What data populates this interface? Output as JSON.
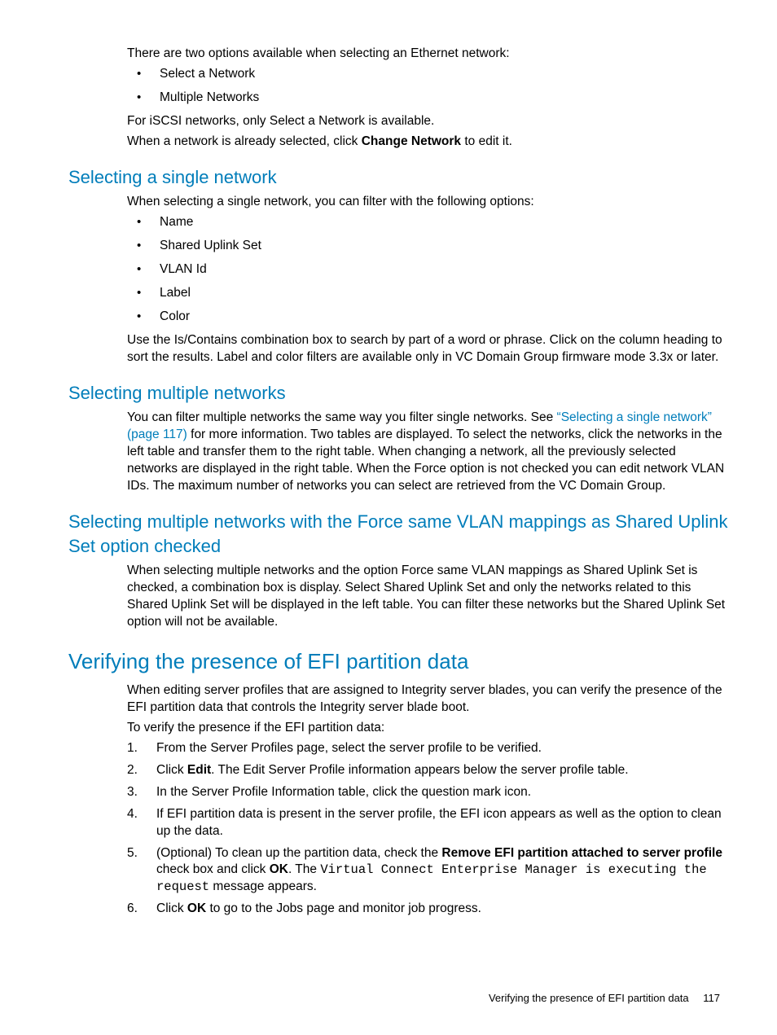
{
  "intro": {
    "lead": "There are two options available when selecting an Ethernet network:",
    "options": [
      "Select a Network",
      "Multiple Networks"
    ],
    "iscsi": "For iSCSI networks, only Select a Network is available.",
    "change_pre": "When a network is already selected, click ",
    "change_bold": "Change Network",
    "change_post": " to edit it."
  },
  "single": {
    "heading": "Selecting a single network",
    "lead": "When selecting a single network, you can filter with the following options:",
    "filters": [
      "Name",
      "Shared Uplink Set",
      "VLAN Id",
      "Label",
      "Color"
    ],
    "note": "Use the Is/Contains combination box to search by part of a word or phrase. Click on the column heading to sort the results.  Label and color filters are available only in VC Domain Group firmware mode 3.3x or later."
  },
  "multi": {
    "heading": "Selecting multiple networks",
    "pre": "You can filter multiple networks the same way you filter single networks. See ",
    "link": "“Selecting a single network” (page 117)",
    "post": " for more information. Two tables are displayed. To select the networks, click the networks in the left table and transfer them to the right table. When changing a network, all the previously selected networks are displayed in the right table. When the Force option is not checked you can edit network VLAN IDs. The maximum number of networks you can select are retrieved from the VC Domain Group."
  },
  "force": {
    "heading": "Selecting multiple networks with the Force same VLAN mappings as Shared Uplink Set option checked",
    "body": "When selecting multiple networks and the option Force same VLAN mappings as Shared Uplink Set is checked, a combination box is display. Select Shared Uplink Set and only the networks related to this Shared Uplink Set will be displayed in the left table. You can filter these networks but the Shared Uplink Set option will not be available."
  },
  "efi": {
    "heading": "Verifying the presence of EFI partition data",
    "p1": "When editing server profiles that are assigned to Integrity server blades, you can verify the presence of the EFI partition data that controls the Integrity server blade boot.",
    "p2": "To verify the presence if the EFI partition data:",
    "steps": {
      "s1": "From the Server Profiles page, select the server profile to be verified.",
      "s2_pre": "Click ",
      "s2_bold": "Edit",
      "s2_post": ". The Edit Server Profile information appears below the server profile table.",
      "s3": "In the Server Profile Information table, click the question mark icon.",
      "s4": "If EFI partition data is present in the server profile, the EFI icon appears as well as the option to clean up the data.",
      "s5_pre": "(Optional) To clean up the partition data, check the ",
      "s5_bold1": "Remove EFI partition attached to server profile",
      "s5_mid": " check box and click ",
      "s5_bold2": "OK",
      "s5_post1": ". The ",
      "s5_mono": "Virtual Connect Enterprise Manager is executing the request",
      "s5_post2": " message appears.",
      "s6_pre": "Click ",
      "s6_bold": "OK",
      "s6_post": " to go to the Jobs page and monitor job progress."
    }
  },
  "footer": {
    "title": "Verifying the presence of EFI partition data",
    "page": "117"
  }
}
